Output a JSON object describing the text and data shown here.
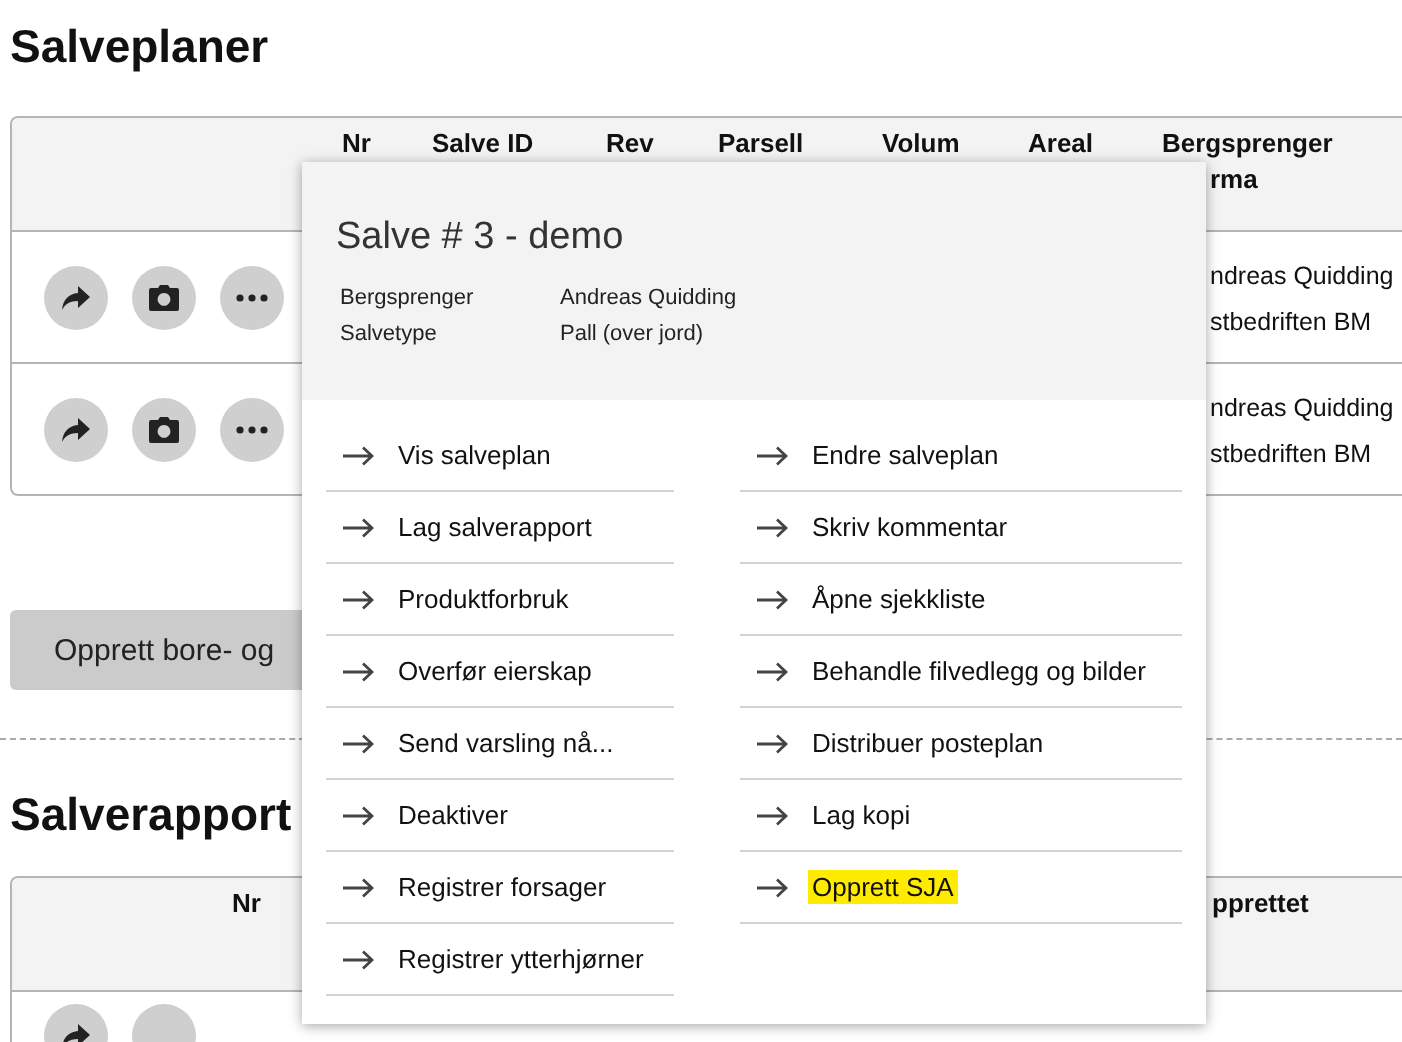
{
  "plans": {
    "title": "Salveplaner",
    "columns": [
      {
        "lines": [
          "Nr"
        ]
      },
      {
        "lines": [
          "Salve ID"
        ]
      },
      {
        "lines": [
          "Rev"
        ]
      },
      {
        "lines": [
          "Parsell"
        ]
      },
      {
        "lines": [
          "Volum"
        ]
      },
      {
        "lines": [
          "Areal"
        ]
      },
      {
        "lines": [
          "Bergsprenger",
          "rma"
        ]
      }
    ],
    "rows": [
      {
        "actions": [
          {
            "kind": "share"
          },
          {
            "kind": "camera"
          },
          {
            "kind": "more"
          }
        ],
        "firma": [
          "ndreas Quidding",
          "stbedriften BM"
        ]
      },
      {
        "actions": [
          {
            "kind": "share"
          },
          {
            "kind": "camera"
          },
          {
            "kind": "more"
          }
        ],
        "firma": [
          "ndreas Quidding",
          "stbedriften BM"
        ]
      }
    ]
  },
  "create_button": "Opprett bore- og",
  "reports": {
    "title": "Salverapport",
    "columns": [
      {
        "lines": [
          "Nr"
        ]
      },
      {
        "lines": [
          "pprettet"
        ]
      }
    ],
    "rows": [
      {
        "actions": [
          {
            "kind": "share"
          },
          {
            "kind": "blank"
          }
        ]
      }
    ]
  },
  "popup": {
    "title": "Salve # 3 - demo",
    "details": [
      {
        "label": "Bergsprenger",
        "value": "Andreas Quidding"
      },
      {
        "label": "Salvetype",
        "value": "Pall (over jord)"
      }
    ],
    "left_items": [
      {
        "label": "Vis salveplan",
        "highlighted": false
      },
      {
        "label": "Lag salverapport",
        "highlighted": false
      },
      {
        "label": "Produktforbruk",
        "highlighted": false
      },
      {
        "label": "Overfør eierskap",
        "highlighted": false
      },
      {
        "label": "Send varsling nå...",
        "highlighted": false
      },
      {
        "label": "Deaktiver",
        "highlighted": false
      },
      {
        "label": "Registrer forsager",
        "highlighted": false
      },
      {
        "label": "Registrer ytterhjørner",
        "highlighted": false
      }
    ],
    "right_items": [
      {
        "label": "Endre salveplan",
        "highlighted": false
      },
      {
        "label": "Skriv kommentar",
        "highlighted": false
      },
      {
        "label": "Åpne sjekkliste",
        "highlighted": false
      },
      {
        "label": "Behandle filvedlegg og bilder",
        "highlighted": false
      },
      {
        "label": "Distribuer posteplan",
        "highlighted": false
      },
      {
        "label": "Lag kopi",
        "highlighted": false
      },
      {
        "label": "Opprett SJA",
        "highlighted": true
      }
    ]
  }
}
